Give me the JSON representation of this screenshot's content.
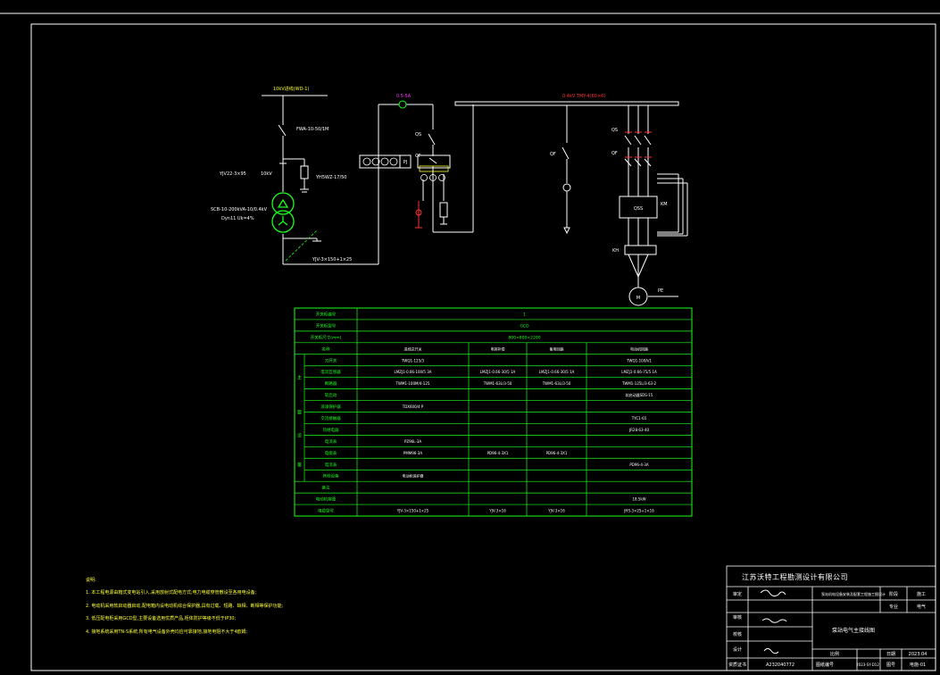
{
  "colors": {
    "background": "#000000",
    "frame": "#ffffff",
    "green": "#1aff1a",
    "yellow": "#ffff33",
    "magenta": "#ff33ff",
    "red": "#ff3333"
  },
  "diagram": {
    "bus_hv_label": "10kV进线(WD-1)",
    "fuse_label": "FWA-10-50/1M",
    "cable_label_left": "YJV22-3×95",
    "surge_label": "YH5WZ-17/50",
    "transformer_label": "SCB-10-200kVA-10/0.4kV",
    "transformer_conn": "Dyn11  Uk=4%",
    "cable_bottom": "YJV-3×150+1×25",
    "hv_label": "10kV",
    "pt_label": "0.5-5A",
    "qs_label_mid": "QS",
    "qf_label_mid": "QF",
    "pj_label": "PJ",
    "busbar_label": "0.4kV  TMY-4(60×6)",
    "qs_label_right": "QS",
    "qf_label_right": "QF",
    "qf_label_branch": "QF",
    "qss_label": "QSS",
    "km_label": "KM",
    "kh_label": "KH",
    "pe_label": "PE"
  },
  "table": {
    "rows": [
      {
        "label": "开关柜编号",
        "cells": [
          "1"
        ],
        "span": true
      },
      {
        "label": "开关柜型号",
        "cells": [
          "GCD"
        ],
        "span": true
      },
      {
        "label": "开关柜尺寸(mm)",
        "cells": [
          "800×800×2200"
        ],
        "span": true
      },
      {
        "label": "名称",
        "cells": [
          "进线总开关",
          "电容补偿",
          "备用回路",
          "电动机回路"
        ],
        "header": true
      },
      {
        "label": "刀开关",
        "cells": [
          "TWQ1-125/3",
          "",
          "",
          "TWQ1-100A/1"
        ],
        "group": "主"
      },
      {
        "label": "电流互感器",
        "cells": [
          "LMZJ1-0.66-100/5 3A",
          "LMZJ1-0.66-30/5 1A",
          "LMZJ1-0.66-30/5 1A",
          "LMZJ1-0.66-75/5 1A"
        ],
        "group": "主"
      },
      {
        "label": "断路器",
        "cells": [
          "TWM1-100M/4-125",
          "TWM1-63L/3-50",
          "TWM1-63L/3-50",
          "TWM1-125L/3-63-2"
        ],
        "group": "主"
      },
      {
        "label": "软启动",
        "cells": [
          "",
          "",
          "",
          "软启动器SDS-15"
        ],
        "group": "主"
      },
      {
        "label": "浪涌保护器",
        "cells": [
          "TDX600/4 P",
          "",
          "",
          ""
        ],
        "group": "要"
      },
      {
        "label": "交流接触器",
        "cells": [
          "",
          "",
          "",
          "TYC1-65"
        ],
        "group": "要"
      },
      {
        "label": "热继电器",
        "cells": [
          "",
          "",
          "",
          "JR28-63-40"
        ],
        "group": "设"
      },
      {
        "label": "电流表",
        "cells": [
          "PZ96L-3A",
          "",
          "",
          ""
        ],
        "group": "设"
      },
      {
        "label": "电能表",
        "cells": [
          "PMM96-3A",
          "PD96-4-3X1",
          "PD96-4-3X1",
          ""
        ],
        "group": "备"
      },
      {
        "label": "电流表",
        "cells": [
          "",
          "",
          "",
          "PD96-4-3A"
        ],
        "group": "备"
      },
      {
        "label": "其他设备",
        "cells": [
          "电动机保护器",
          "",
          "",
          ""
        ],
        "group": "备"
      },
      {
        "label": "备注",
        "cells": [
          "",
          "",
          "",
          ""
        ]
      },
      {
        "label": "电动机容量",
        "cells": [
          "",
          "",
          "",
          "18.5kW"
        ]
      },
      {
        "label": "电缆型号",
        "cells": [
          "YJV-3×150+1×25",
          "YJV-3×16",
          "YJV-3×16",
          "JHS-3×25+1×16"
        ]
      }
    ]
  },
  "notes": {
    "title": "说明:",
    "lines": [
      "1. 本工程电源由箱式变电站引入,采用放射式配电方式;电力电缆穿管敷设至各用电设备;",
      "2. 电动机采用软启动器启动,配电箱内设电动机综合保护器,具有过载、短路、缺相、断相等保护功能;",
      "3. 低压配电柜采用GCD型,主要设备选用优质产品,柜体防护等级不低于IP30;",
      "4. 接地系统采用TN-S系统,所有电气设备外壳均应可靠接地,接地电阻不大于4欧姆;"
    ]
  },
  "title_block": {
    "company": "江苏沃特工程勘测设计有限公司",
    "project": "泵站机电设备安装及配套工程施工图设计",
    "design_stage_label": "阶段",
    "design_stage": "施工",
    "discipline_label": "专业",
    "discipline": "电气",
    "role_approve": "审定",
    "role_check": "审核",
    "role_review": "校核",
    "role_design": "设计",
    "drawing_title": "泵站电气主接线图",
    "scale_label": "比例",
    "scale": "",
    "date_label": "日期",
    "date": "2023.04",
    "cert_label": "资质证书",
    "cert_no": "A232040772",
    "drawing_no_label": "图纸编号",
    "drawing_no": "2023-SY-D12",
    "sheet_label": "图号",
    "sheet": "电施-01"
  }
}
